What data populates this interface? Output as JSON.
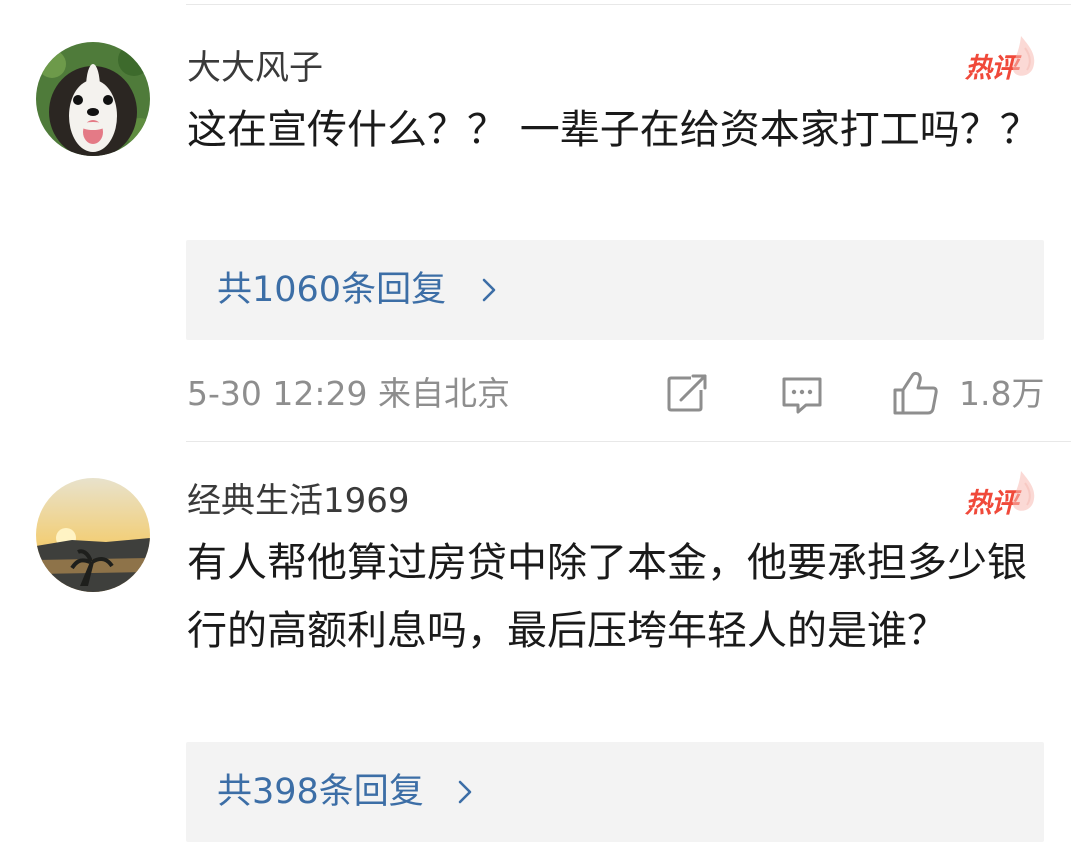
{
  "comments": [
    {
      "username": "大大风子",
      "badge": "热评",
      "text": "这在宣传什么？？ 一辈子在给资本家打工吗？？",
      "replies": "共1060条回复",
      "meta": "5-30 12:29 来自北京",
      "likes": "1.8万",
      "avatar": "dog-avatar"
    },
    {
      "username": "经典生活1969",
      "badge": "热评",
      "text": "有人帮他算过房贷中除了本金，他要承担多少银行的高额利息吗，最后压垮年轻人的是谁？",
      "replies": "共398条回复",
      "avatar": "sunset-avatar"
    }
  ],
  "icons": {
    "share": "share-icon",
    "comment": "comment-icon",
    "like": "like-icon",
    "chevron": "chevron-right-icon",
    "flame": "flame-icon"
  },
  "colors": {
    "link": "#3c6ea6",
    "hot": "#f0493a",
    "meta": "#8e8e8e",
    "reply_bg": "#f3f3f3"
  }
}
